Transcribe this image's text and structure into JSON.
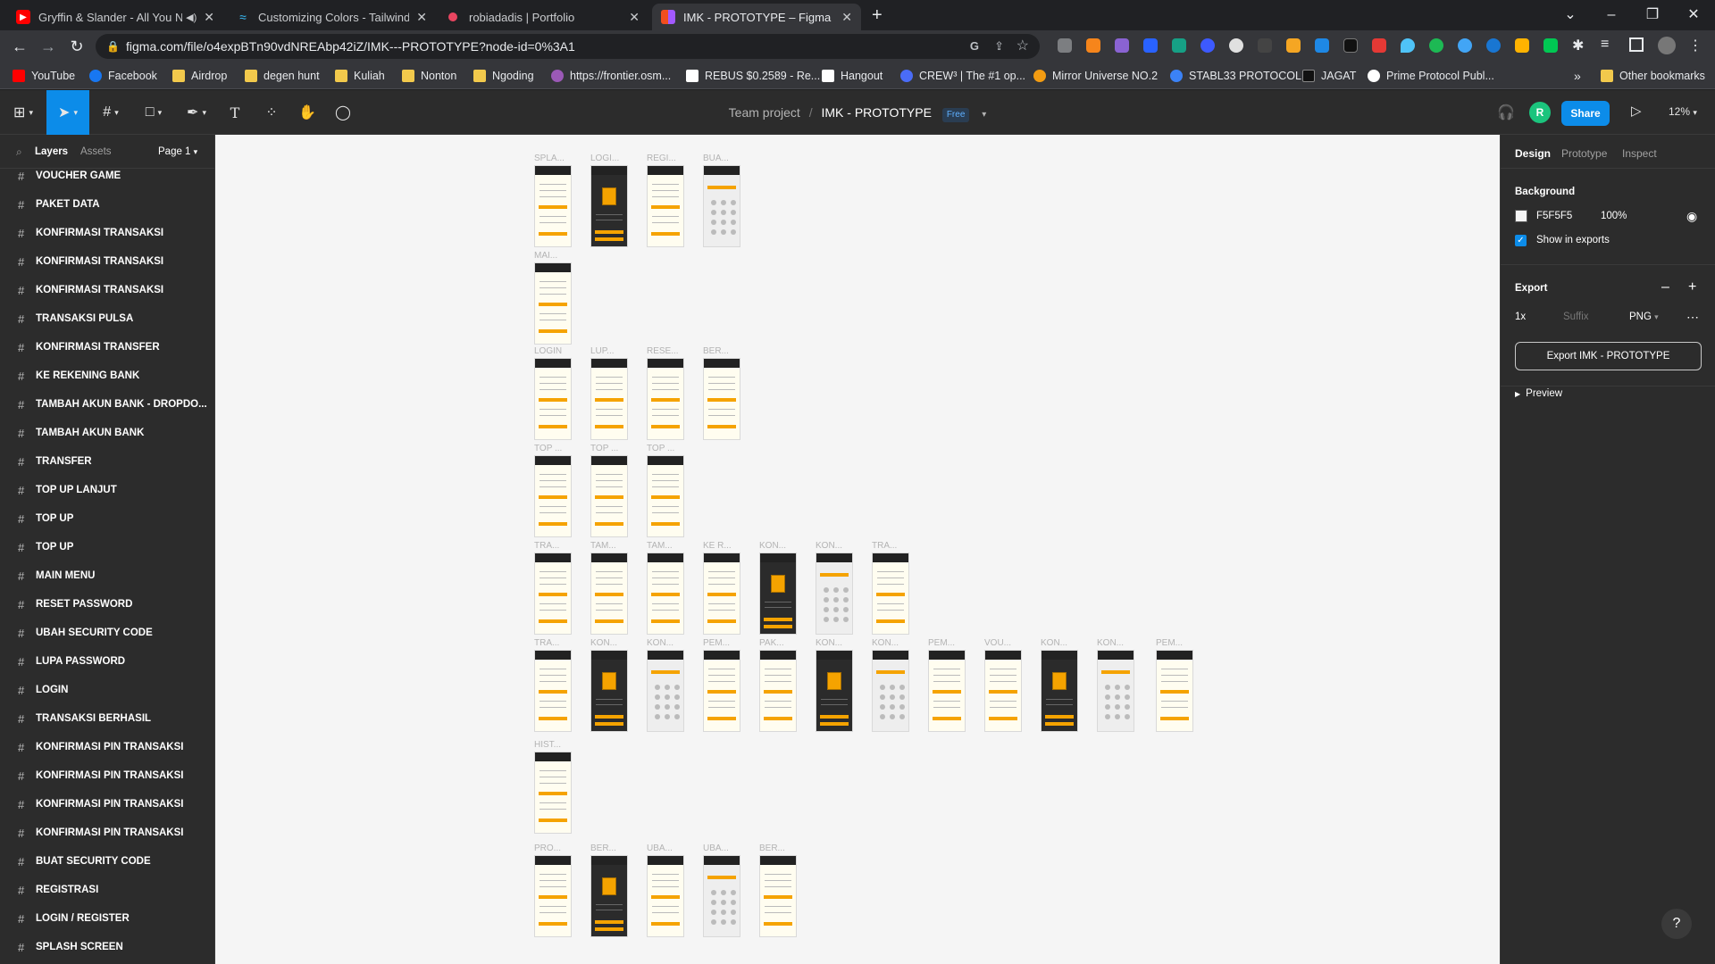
{
  "browser": {
    "tabs": [
      {
        "title": "Gryffin & Slander - All You N",
        "favicon": "youtube-icon",
        "color": "#ff0000"
      },
      {
        "title": "Customizing Colors - Tailwind CS",
        "favicon": "tailwind-icon",
        "color": "#38bdf8"
      },
      {
        "title": "robiadadis | Portfolio",
        "favicon": "portfolio-icon",
        "color": "#e94560"
      },
      {
        "title": "IMK - PROTOTYPE – Figma",
        "favicon": "figma-icon",
        "color": "#f24e1e"
      }
    ],
    "url": "figma.com/file/o4expBTn90vdNREAbp42iZ/IMK---PROTOTYPE?node-id=0%3A1",
    "bookmarks": [
      {
        "label": "YouTube",
        "icon": "youtube-icon",
        "color": "#ff0000"
      },
      {
        "label": "Facebook",
        "icon": "facebook-icon",
        "color": "#1877f2"
      },
      {
        "label": "Airdrop",
        "icon": "folder-icon",
        "color": "#f2c94c"
      },
      {
        "label": "degen hunt",
        "icon": "folder-icon",
        "color": "#f2c94c"
      },
      {
        "label": "Kuliah",
        "icon": "folder-icon",
        "color": "#f2c94c"
      },
      {
        "label": "Nonton",
        "icon": "folder-icon",
        "color": "#f2c94c"
      },
      {
        "label": "Ngoding",
        "icon": "folder-icon",
        "color": "#f2c94c"
      },
      {
        "label": "https://frontier.osm...",
        "icon": "link-icon",
        "color": "#9b59b6"
      },
      {
        "label": "REBUS $0.2589 - Re...",
        "icon": "rebus-icon",
        "color": "#ffffff"
      },
      {
        "label": "Hangout",
        "icon": "hangout-icon",
        "color": "#ffffff"
      },
      {
        "label": "CREW³ | The #1 op...",
        "icon": "crew-icon",
        "color": "#4a6cf7"
      },
      {
        "label": "Mirror Universe NO.2",
        "icon": "mirror-icon",
        "color": "#f39c12"
      },
      {
        "label": "STABL33 PROTOCOL",
        "icon": "stabl-icon",
        "color": "#3b82f6"
      },
      {
        "label": "JAGAT",
        "icon": "jagat-icon",
        "color": "#111111"
      },
      {
        "label": "Prime Protocol Publ...",
        "icon": "prime-icon",
        "color": "#ffffff"
      }
    ],
    "more_bookmarks": "»",
    "other_bookmarks": "Other bookmarks"
  },
  "figma": {
    "breadcrumb_team": "Team project",
    "breadcrumb_sep": "/",
    "file_name": "IMK - PROTOTYPE",
    "plan_badge": "Free",
    "share_label": "Share",
    "zoom_label": "12%",
    "avatar_initial": "R",
    "accent": "#0c8ce9",
    "left_panel": {
      "tab_layers": "Layers",
      "tab_assets": "Assets",
      "page": "Page 1",
      "layers": [
        "VOUCHER GAME",
        "PAKET DATA",
        "KONFIRMASI TRANSAKSI",
        "KONFIRMASI TRANSAKSI",
        "KONFIRMASI TRANSAKSI",
        "TRANSAKSI PULSA",
        "KONFIRMASI TRANSFER",
        "KE REKENING BANK",
        "TAMBAH AKUN BANK - DROPDO...",
        "TAMBAH AKUN BANK",
        "TRANSFER",
        "TOP UP LANJUT",
        "TOP UP",
        "TOP UP",
        "MAIN MENU",
        "RESET PASSWORD",
        "UBAH SECURITY CODE",
        "LUPA PASSWORD",
        "LOGIN",
        "TRANSAKSI BERHASIL",
        "KONFIRMASI PIN TRANSAKSI",
        "KONFIRMASI PIN TRANSAKSI",
        "KONFIRMASI PIN TRANSAKSI",
        "KONFIRMASI PIN TRANSAKSI",
        "BUAT SECURITY CODE",
        "REGISTRASI",
        "LOGIN / REGISTER",
        "SPLASH SCREEN"
      ]
    },
    "right_panel": {
      "tab_design": "Design",
      "tab_prototype": "Prototype",
      "tab_inspect": "Inspect",
      "background_title": "Background",
      "bg_hex": "F5F5F5",
      "bg_opacity": "100%",
      "show_in_exports": "Show in exports",
      "export_title": "Export",
      "export_scale": "1x",
      "export_suffix_placeholder": "Suffix",
      "export_format": "PNG",
      "export_button": "Export IMK - PROTOTYPE",
      "preview_label": "Preview"
    },
    "canvas_frames": [
      {
        "label": "SPLA...",
        "theme": "light"
      },
      {
        "label": "LOGI...",
        "theme": "dark"
      },
      {
        "label": "REGI...",
        "theme": "light"
      },
      {
        "label": "BUA...",
        "theme": "gray"
      },
      {
        "label": "MAI...",
        "theme": "light"
      },
      {
        "label": "LOGIN",
        "theme": "light"
      },
      {
        "label": "LUP...",
        "theme": "light"
      },
      {
        "label": "RESE...",
        "theme": "light"
      },
      {
        "label": "BER...",
        "theme": "light"
      },
      {
        "label": "TOP ...",
        "theme": "light"
      },
      {
        "label": "TOP ...",
        "theme": "light"
      },
      {
        "label": "TOP ...",
        "theme": "light"
      },
      {
        "label": "TRA...",
        "theme": "light"
      },
      {
        "label": "TAM...",
        "theme": "light"
      },
      {
        "label": "TAM...",
        "theme": "light"
      },
      {
        "label": "KE R...",
        "theme": "light"
      },
      {
        "label": "KON...",
        "theme": "dark"
      },
      {
        "label": "KON...",
        "theme": "gray"
      },
      {
        "label": "TRA...",
        "theme": "light"
      },
      {
        "label": "TRA...",
        "theme": "light"
      },
      {
        "label": "KON...",
        "theme": "dark"
      },
      {
        "label": "KON...",
        "theme": "gray"
      },
      {
        "label": "PEM...",
        "theme": "light"
      },
      {
        "label": "PAK...",
        "theme": "light"
      },
      {
        "label": "KON...",
        "theme": "dark"
      },
      {
        "label": "KON...",
        "theme": "gray"
      },
      {
        "label": "PEM...",
        "theme": "light"
      },
      {
        "label": "VOU...",
        "theme": "light"
      },
      {
        "label": "KON...",
        "theme": "dark"
      },
      {
        "label": "KON...",
        "theme": "gray"
      },
      {
        "label": "PEM...",
        "theme": "light"
      },
      {
        "label": "HIST...",
        "theme": "light"
      },
      {
        "label": "PRO...",
        "theme": "light"
      },
      {
        "label": "BER...",
        "theme": "dark"
      },
      {
        "label": "UBA...",
        "theme": "light"
      },
      {
        "label": "UBA...",
        "theme": "gray"
      },
      {
        "label": "BER...",
        "theme": "light"
      }
    ]
  }
}
